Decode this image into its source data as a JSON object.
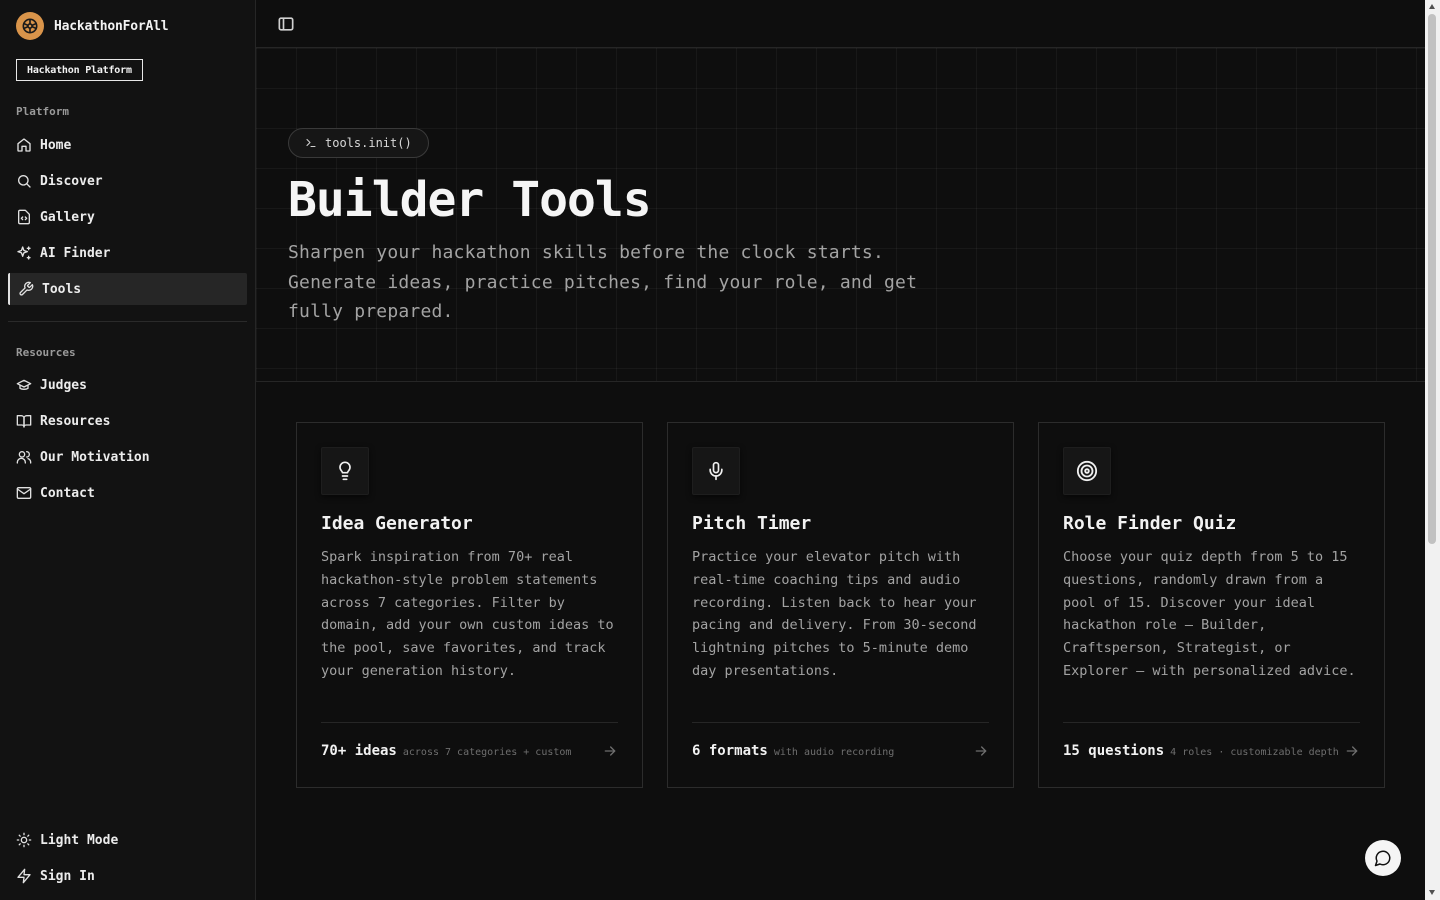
{
  "brand": {
    "name": "HackathonForAll",
    "badge": "Hackathon Platform"
  },
  "sidebar": {
    "platform_label": "Platform",
    "platform_items": [
      {
        "label": "Home",
        "icon": "home-icon"
      },
      {
        "label": "Discover",
        "icon": "search-icon"
      },
      {
        "label": "Gallery",
        "icon": "code-file-icon"
      },
      {
        "label": "AI Finder",
        "icon": "sparkles-icon"
      },
      {
        "label": "Tools",
        "icon": "wrench-icon",
        "active": true
      }
    ],
    "resources_label": "Resources",
    "resource_items": [
      {
        "label": "Judges",
        "icon": "graduation-cap-icon"
      },
      {
        "label": "Resources",
        "icon": "book-open-icon"
      },
      {
        "label": "Our Motivation",
        "icon": "users-icon"
      },
      {
        "label": "Contact",
        "icon": "mail-icon"
      }
    ],
    "footer_items": [
      {
        "label": "Light Mode",
        "icon": "sun-icon"
      },
      {
        "label": "Sign In",
        "icon": "zap-icon"
      }
    ]
  },
  "hero": {
    "pill": "tools.init()",
    "title": "Builder Tools",
    "subtitle": "Sharpen your hackathon skills before the clock starts. Generate ideas, practice pitches, find your role, and get fully prepared."
  },
  "cards": [
    {
      "icon": "lightbulb-icon",
      "title": "Idea Generator",
      "description": "Spark inspiration from 70+ real hackathon-style problem statements across 7 categories. Filter by domain, add your own custom ideas to the pool, save favorites, and track your generation history.",
      "stat": "70+ ideas",
      "stat_sub": "across 7 categories + custom"
    },
    {
      "icon": "microphone-icon",
      "title": "Pitch Timer",
      "description": "Practice your elevator pitch with real-time coaching tips and audio recording. Listen back to hear your pacing and delivery. From 30-second lightning pitches to 5-minute demo day presentations.",
      "stat": "6 formats",
      "stat_sub": "with audio recording"
    },
    {
      "icon": "target-icon",
      "title": "Role Finder Quiz",
      "description": "Choose your quiz depth from 5 to 15 questions, randomly drawn from a pool of 15. Discover your ideal hackathon role — Builder, Craftsperson, Strategist, or Explorer — with personalized advice.",
      "stat": "15 questions",
      "stat_sub": "4 roles · customizable depth"
    }
  ],
  "colors": {
    "background": "#0e0e0e",
    "sidebar": "#121212",
    "brand_accent": "#d9944a",
    "border": "#2c2c2c"
  }
}
